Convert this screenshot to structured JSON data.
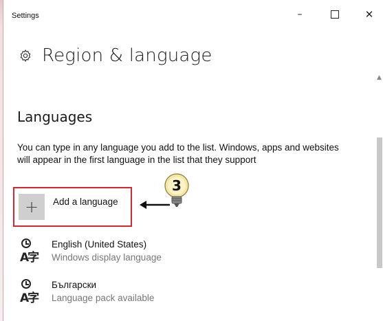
{
  "window": {
    "title": "Settings",
    "minimize_glyph": "–",
    "close_glyph": "✕"
  },
  "header": {
    "title": "Region & language",
    "icon": "gear-icon"
  },
  "languages": {
    "section_title": "Languages",
    "description": "You can type in any language you add to the list. Windows, apps and websites will appear in the first language in the list that they support",
    "add_button": {
      "plus_glyph": "+",
      "label": "Add a language"
    },
    "items": [
      {
        "name": "English (United States)",
        "status": "Windows display language",
        "icon": "language-icon"
      },
      {
        "name": "Български",
        "status": "Language pack available",
        "icon": "language-icon"
      }
    ]
  },
  "callout": {
    "step_number": "3",
    "highlight_color": "#d9252d"
  }
}
